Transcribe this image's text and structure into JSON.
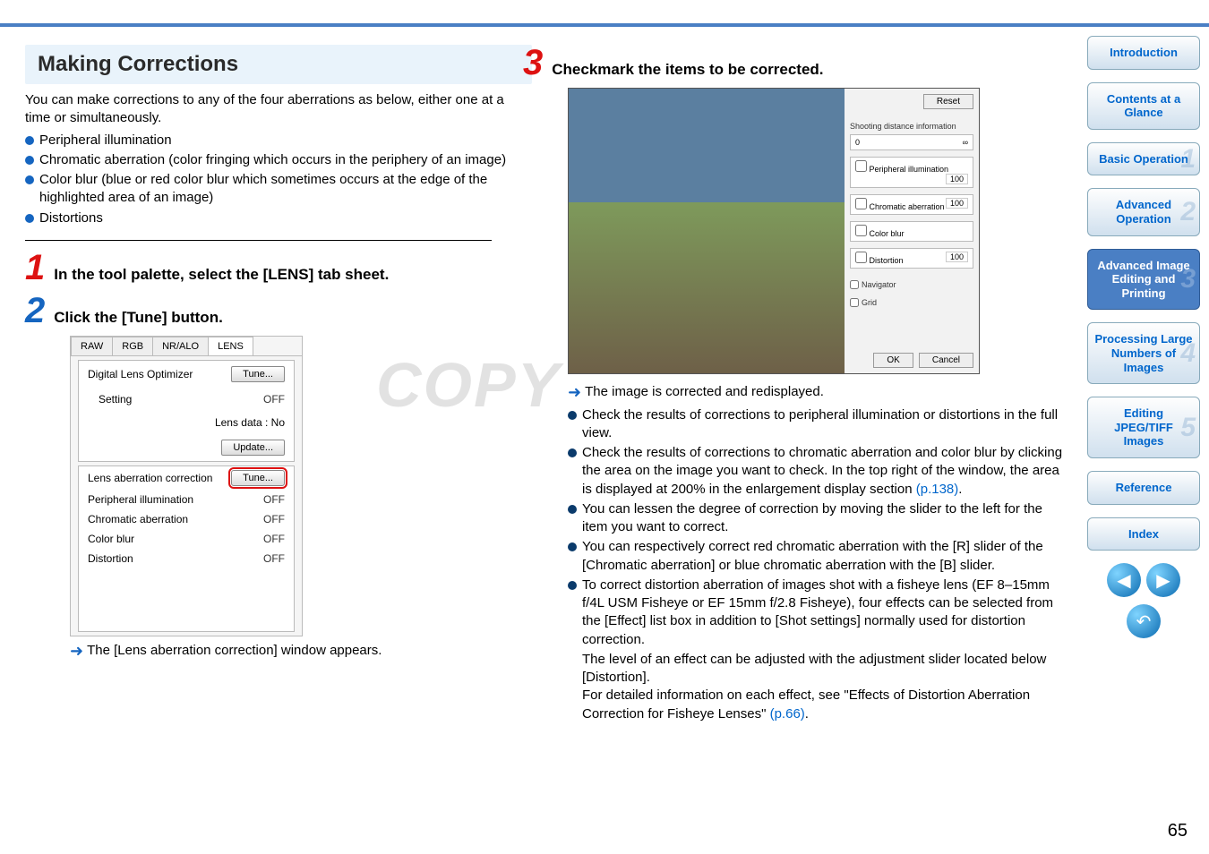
{
  "left": {
    "heading": "Making Corrections",
    "intro": "You can make corrections to any of the four aberrations as below, either one at a time or simultaneously.",
    "bullets": [
      "Peripheral illumination",
      "Chromatic aberration (color fringing which occurs in the periphery of an image)",
      "Color blur (blue or red color blur which sometimes occurs at the edge of the highlighted area of an image)",
      "Distortions"
    ],
    "step1_title": "In the tool palette, select the [LENS] tab sheet.",
    "step2_title": "Click the [Tune] button.",
    "panel": {
      "tabs": [
        "RAW",
        "RGB",
        "NR/ALO",
        "LENS"
      ],
      "digital_lens_optimizer": "Digital Lens Optimizer",
      "tune": "Tune...",
      "setting": "Setting",
      "off": "OFF",
      "lens_data": "Lens data : No",
      "update": "Update...",
      "lens_ab_corr": "Lens aberration correction",
      "tune2": "Tune...",
      "rows": [
        {
          "label": "Peripheral illumination",
          "val": "OFF"
        },
        {
          "label": "Chromatic aberration",
          "val": "OFF"
        },
        {
          "label": "Color blur",
          "val": "OFF"
        },
        {
          "label": "Distortion",
          "val": "OFF"
        }
      ]
    },
    "step2_result": "The [Lens aberration correction] window appears."
  },
  "right": {
    "step3_title": "Checkmark the items to be corrected.",
    "dialog": {
      "reset": "Reset",
      "shooting_info": "Shooting distance information",
      "items": [
        "Peripheral illumination",
        "Chromatic aberration",
        "Color blur",
        "Distortion"
      ],
      "vals": [
        "100",
        "100",
        "",
        "100"
      ],
      "navigator": "Navigator",
      "grid": "Grid",
      "ok": "OK",
      "cancel": "Cancel"
    },
    "result1": "The image is corrected and redisplayed.",
    "bullets": [
      {
        "text": "Check the results of corrections to peripheral illumination or distortions in the full view."
      },
      {
        "text": "Check the results of corrections to chromatic aberration and color blur by clicking the area on the image you want to check. In the top right of the window, the area is displayed at 200% in the enlargement display section ",
        "link": "(p.138)",
        "after": "."
      },
      {
        "text": "You can lessen the degree of correction by moving the slider to the left for the item you want to correct."
      },
      {
        "text": "You can respectively correct red chromatic aberration with the [R] slider of the [Chromatic aberration] or blue chromatic aberration with the [B] slider."
      },
      {
        "text": "To correct distortion aberration of images shot with a fisheye lens (EF 8–15mm f/4L USM Fisheye or EF 15mm f/2.8 Fisheye), four effects can be selected from the [Effect] list box in addition to [Shot settings] normally used for distortion correction."
      }
    ],
    "extra1": "The level of an effect can be adjusted with the adjustment slider located below [Distortion].",
    "extra2": "For detailed information on each effect, see \"Effects of Distortion Aberration Correction for Fisheye Lenses\" ",
    "extra2_link": "(p.66)",
    "extra2_after": "."
  },
  "nav": {
    "intro": "Introduction",
    "contents": "Contents at a Glance",
    "basic": "Basic Operation",
    "advanced_op": "Advanced Operation",
    "advanced_img": "Advanced Image Editing and Printing",
    "processing": "Processing Large Numbers of Images",
    "editing": "Editing JPEG/TIFF Images",
    "reference": "Reference",
    "index": "Index"
  },
  "watermark": "COPY",
  "page_number": "65"
}
